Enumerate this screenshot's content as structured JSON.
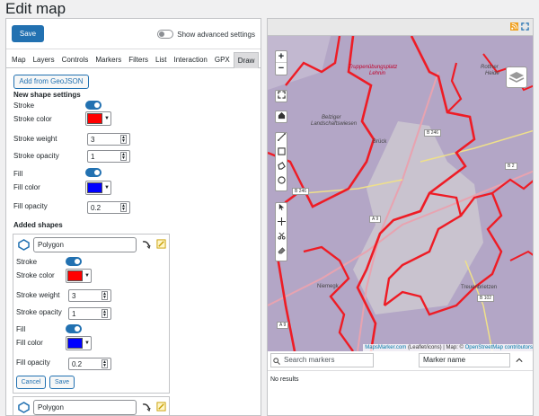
{
  "page": {
    "title": "Edit map"
  },
  "toolbar": {
    "save_label": "Save",
    "advanced_label": "Show advanced settings"
  },
  "tabs": [
    {
      "label": "Map"
    },
    {
      "label": "Layers"
    },
    {
      "label": "Controls"
    },
    {
      "label": "Markers"
    },
    {
      "label": "Filters"
    },
    {
      "label": "List"
    },
    {
      "label": "Interaction"
    },
    {
      "label": "GPX"
    },
    {
      "label": "Draw",
      "active": true
    }
  ],
  "draw": {
    "add_geojson_label": "Add from GeoJSON",
    "new_shape_title": "New shape settings",
    "stroke_label": "Stroke",
    "stroke_color_label": "Stroke color",
    "stroke_color": "#ff0000",
    "stroke_weight_label": "Stroke weight",
    "stroke_weight": "3",
    "stroke_opacity_label": "Stroke opacity",
    "stroke_opacity": "1",
    "fill_label": "Fill",
    "fill_color_label": "Fill color",
    "fill_color": "#0000ff",
    "fill_opacity_label": "Fill opacity",
    "fill_opacity": "0.2",
    "added_shapes_title": "Added shapes",
    "shapes": [
      {
        "name": "Polygon",
        "stroke_label": "Stroke",
        "stroke_color_label": "Stroke color",
        "stroke_color": "#ff0000",
        "stroke_weight_label": "Stroke weight",
        "stroke_weight": "3",
        "stroke_opacity_label": "Stroke opacity",
        "stroke_opacity": "1",
        "fill_label": "Fill",
        "fill_color_label": "Fill color",
        "fill_color": "#0000ff",
        "fill_opacity_label": "Fill opacity",
        "fill_opacity": "0.2",
        "cancel_label": "Cancel",
        "save_label": "Save"
      },
      {
        "name": "Polygon"
      }
    ]
  },
  "map": {
    "labels": {
      "truppen": "Truppenübungsplatz",
      "lehnin": "Lehnin",
      "rottner": "Rottner",
      "heide": "Heide",
      "belziger": "Belziger",
      "landschaftswiesen": "Landschaftswiesen",
      "bruck": "Brück",
      "niemegk": "Niemegk",
      "treuenbrietzen": "Treuenbrietzen"
    },
    "roads": {
      "b246a": "B 246",
      "b246b": "B 246",
      "b2": "B 2",
      "a9a": "A 9",
      "a9b": "A 9",
      "b102": "B 102"
    },
    "attribution": {
      "maps_marker": "MapsMarker.com",
      "leaflet": "(Leaflet/icons)",
      "map_text": "| Map: ©",
      "osm": "OpenStreetMap contributors"
    },
    "search_placeholder": "Search markers",
    "sort_value": "Marker name",
    "no_results": "No results"
  },
  "colors": {
    "accent": "#2271b1",
    "map_fill": "#b3a6c6",
    "boundary": "#ee1c25"
  }
}
